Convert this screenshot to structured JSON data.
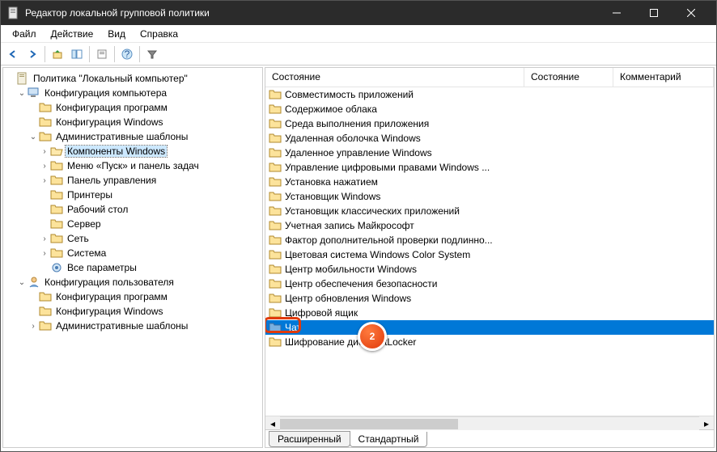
{
  "window": {
    "title": "Редактор локальной групповой политики"
  },
  "menu": {
    "file": "Файл",
    "action": "Действие",
    "view": "Вид",
    "help": "Справка"
  },
  "tree": {
    "root": "Политика \"Локальный компьютер\"",
    "comp_config": "Конфигурация компьютера",
    "prog_config": "Конфигурация программ",
    "win_config": "Конфигурация Windows",
    "admin_templates": "Административные шаблоны",
    "win_components": "Компоненты Windows",
    "start_menu": "Меню «Пуск» и панель задач",
    "control_panel": "Панель управления",
    "printers": "Принтеры",
    "desktop": "Рабочий стол",
    "server": "Сервер",
    "network": "Сеть",
    "system": "Система",
    "all_settings": "Все параметры",
    "user_config": "Конфигурация пользователя",
    "u_prog_config": "Конфигурация программ",
    "u_win_config": "Конфигурация Windows",
    "u_admin_templates": "Административные шаблоны"
  },
  "columns": {
    "state": "Состояние",
    "state2": "Состояние",
    "comment": "Комментарий"
  },
  "list": [
    "Совместимость приложений",
    "Содержимое облака",
    "Среда выполнения приложения",
    "Удаленная оболочка Windows",
    "Удаленное управление Windows",
    "Управление цифровыми правами Windows ...",
    "Установка нажатием",
    "Установщик Windows",
    "Установщик классических приложений",
    "Учетная запись Майкрософт",
    "Фактор дополнительной проверки подлинно...",
    "Цветовая система Windows Color System",
    "Центр мобильности Windows",
    "Центр обеспечения безопасности",
    "Центр обновления Windows",
    "Цифровой ящик",
    "Чат",
    "Шифрование диска BitLocker"
  ],
  "selected_index": 16,
  "tabs": {
    "extended": "Расширенный",
    "standard": "Стандартный"
  },
  "badge": "2"
}
